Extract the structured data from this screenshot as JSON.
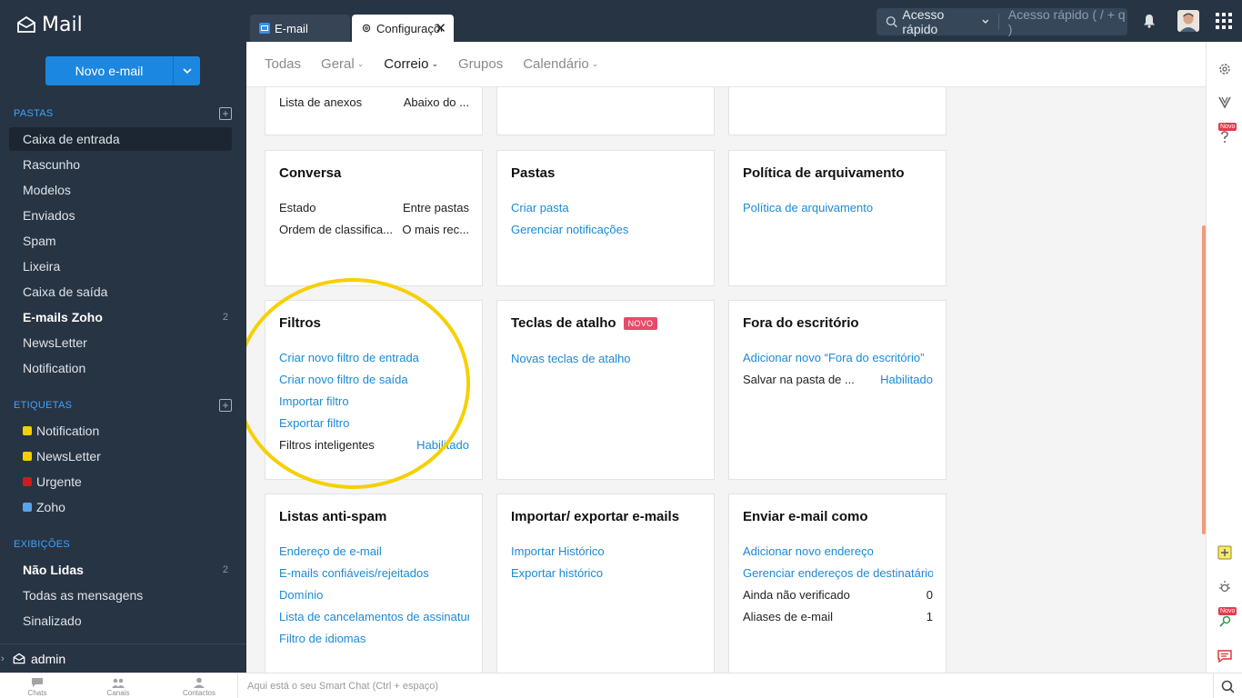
{
  "app": {
    "title": "Mail"
  },
  "compose": {
    "label": "Novo e-mail"
  },
  "folders": {
    "heading": "PASTAS",
    "items": [
      {
        "label": "Caixa de entrada",
        "count": ""
      },
      {
        "label": "Rascunho",
        "count": ""
      },
      {
        "label": "Modelos",
        "count": ""
      },
      {
        "label": "Enviados",
        "count": ""
      },
      {
        "label": "Spam",
        "count": ""
      },
      {
        "label": "Lixeira",
        "count": ""
      },
      {
        "label": "Caixa de saída",
        "count": ""
      },
      {
        "label": "E-mails Zoho",
        "count": "2"
      },
      {
        "label": "NewsLetter",
        "count": ""
      },
      {
        "label": "Notification",
        "count": ""
      }
    ]
  },
  "tags": {
    "heading": "ETIQUETAS",
    "items": [
      {
        "label": "Notification",
        "color": "#f5d000"
      },
      {
        "label": "NewsLetter",
        "color": "#f5d000"
      },
      {
        "label": "Urgente",
        "color": "#c81e1e"
      },
      {
        "label": "Zoho",
        "color": "#5aa2e8"
      }
    ]
  },
  "views": {
    "heading": "EXIBIÇÕES",
    "items": [
      {
        "label": "Não Lidas",
        "count": "2"
      },
      {
        "label": "Todas as mensagens",
        "count": ""
      },
      {
        "label": "Sinalizado",
        "count": ""
      }
    ]
  },
  "user": {
    "name": "admin"
  },
  "tabs": {
    "mail": "E-mail",
    "config": "Configurações"
  },
  "quick": {
    "label": "Acesso rápido",
    "placeholder": "Acesso rápido  ( / + q )"
  },
  "settings_nav": [
    "Todas",
    "Geral",
    "Correio",
    "Grupos",
    "Calendário"
  ],
  "cards": {
    "top_partial": {
      "label": "Lista de anexos",
      "value": "Abaixo do ..."
    },
    "conversa": {
      "title": "Conversa",
      "rows": [
        {
          "label": "Estado",
          "value": "Entre pastas"
        },
        {
          "label": "Ordem de classifica...",
          "value": "O mais rec..."
        }
      ]
    },
    "pastas": {
      "title": "Pastas",
      "links": [
        "Criar pasta",
        "Gerenciar notificações"
      ]
    },
    "politica": {
      "title": "Política de arquivamento",
      "links": [
        "Política de arquivamento"
      ]
    },
    "filtros": {
      "title": "Filtros",
      "links": [
        "Criar novo filtro de entrada",
        "Criar novo filtro de saída",
        "Importar filtro",
        "Exportar filtro"
      ],
      "smart_label": "Filtros inteligentes",
      "smart_value": "Habilitado"
    },
    "teclas": {
      "title": "Teclas de atalho",
      "badge": "NOVO",
      "links": [
        "Novas teclas de atalho"
      ]
    },
    "fora": {
      "title": "Fora do escritório",
      "links": [
        "Adicionar novo “Fora do escritório”"
      ],
      "save_label": "Salvar na pasta de ...",
      "save_value": "Habilitado"
    },
    "antispam": {
      "title": "Listas anti-spam",
      "links": [
        "Endereço de e-mail",
        "E-mails confiáveis/rejeitados",
        "Domínio",
        "Lista de cancelamentos de assinatura",
        "Filtro de idiomas"
      ]
    },
    "importar": {
      "title": "Importar/ exportar e-mails",
      "links": [
        "Importar Histórico",
        "Exportar histórico"
      ]
    },
    "enviar": {
      "title": "Enviar e-mail como",
      "links": [
        "Adicionar novo endereço",
        "Gerenciar endereços de destinatário"
      ],
      "rows": [
        {
          "label": "Ainda não verificado",
          "value": "0"
        },
        {
          "label": "Aliases de e-mail",
          "value": "1"
        }
      ]
    }
  },
  "rail": {
    "new_badge": "Novo"
  },
  "bottom": {
    "chats": "Chats",
    "canais": "Canais",
    "contactos": "Contactos",
    "smart_chat": "Aqui está o seu Smart Chat (Ctrl + espaço)"
  },
  "colors": {
    "sidebar": "#273444",
    "accent": "#1b87e0",
    "link": "#1a8ad6",
    "highlight": "#f6d000"
  }
}
